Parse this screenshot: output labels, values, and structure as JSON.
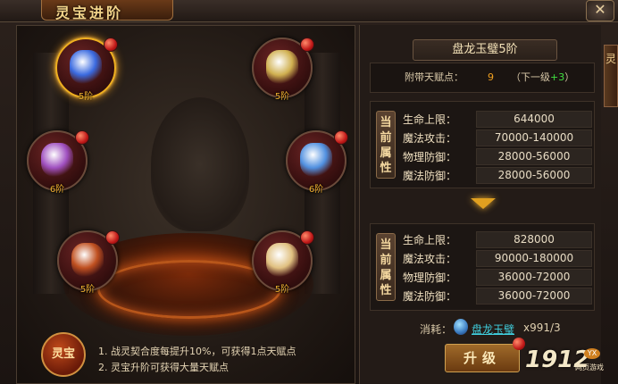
{
  "window": {
    "title": "灵宝进阶",
    "close_glyph": "✕",
    "side_tab": "灵"
  },
  "orbs": [
    {
      "name": "orb-blue-flame",
      "level": "5阶",
      "selected": true,
      "color": "#3a6ae0"
    },
    {
      "name": "orb-golden-mirror",
      "level": "5阶",
      "selected": false,
      "color": "#d0b050"
    },
    {
      "name": "orb-purple-gourd",
      "level": "6阶",
      "selected": false,
      "color": "#a050c0"
    },
    {
      "name": "orb-ice-crystal",
      "level": "6阶",
      "selected": false,
      "color": "#5090e0"
    },
    {
      "name": "orb-red-umbrella",
      "level": "5阶",
      "selected": false,
      "color": "#c05020"
    },
    {
      "name": "orb-bagua-mirror",
      "level": "5阶",
      "selected": false,
      "color": "#e0c080"
    }
  ],
  "panel": {
    "item_name": "盘龙玉璧5阶",
    "talent_label": "附带天赋点：",
    "talent_value": "9",
    "next_open": "（下一级",
    "next_plus": "+3",
    "next_close": "）"
  },
  "current_attrs": {
    "tag": "当前属性",
    "rows": [
      {
        "k": "生命上限：",
        "v": "644000"
      },
      {
        "k": "魔法攻击：",
        "v": "70000-140000"
      },
      {
        "k": "物理防御：",
        "v": "28000-56000"
      },
      {
        "k": "魔法防御：",
        "v": "28000-56000"
      }
    ]
  },
  "next_attrs": {
    "tag": "当前属性",
    "rows": [
      {
        "k": "生命上限：",
        "v": "828000"
      },
      {
        "k": "魔法攻击：",
        "v": "90000-180000"
      },
      {
        "k": "物理防御：",
        "v": "36000-72000"
      },
      {
        "k": "魔法防御：",
        "v": "36000-72000"
      }
    ]
  },
  "cost": {
    "label": "消耗：",
    "item": "盘龙玉璧",
    "count": "x991/3"
  },
  "upgrade_label": "升级",
  "badge": "灵宝",
  "tips": [
    "1. 战灵契合度每提升10%，可获得1点天赋点",
    "2. 灵宝升阶可获得大量天赋点"
  ],
  "watermark": {
    "main": "1912",
    "yx": "YX",
    "sub": "网页游戏"
  }
}
